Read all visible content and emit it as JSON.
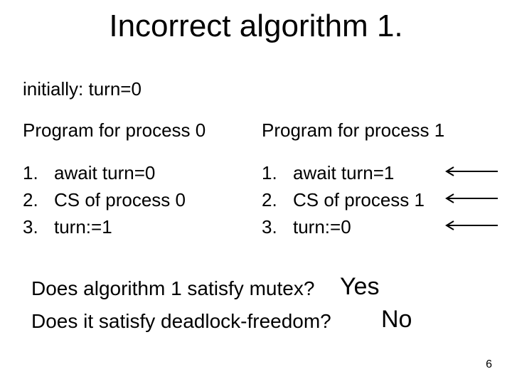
{
  "title": "Incorrect algorithm 1.",
  "initially": "initially: turn=0",
  "left": {
    "header": "Program for process 0",
    "steps": [
      {
        "n": "1.",
        "t": "await  turn=0"
      },
      {
        "n": "2.",
        "t": "CS of process 0"
      },
      {
        "n": "3.",
        "t": "turn:=1"
      }
    ]
  },
  "right": {
    "header": "Program for process 1",
    "steps": [
      {
        "n": "1.",
        "t": "await  turn=1"
      },
      {
        "n": "2.",
        "t": "CS of process 1"
      },
      {
        "n": "3.",
        "t": "turn:=0"
      }
    ]
  },
  "q1": "Does algorithm 1 satisfy mutex?",
  "ans1": "Yes",
  "q2": "Does it satisfy deadlock-freedom?",
  "ans2": "No",
  "page": "6"
}
